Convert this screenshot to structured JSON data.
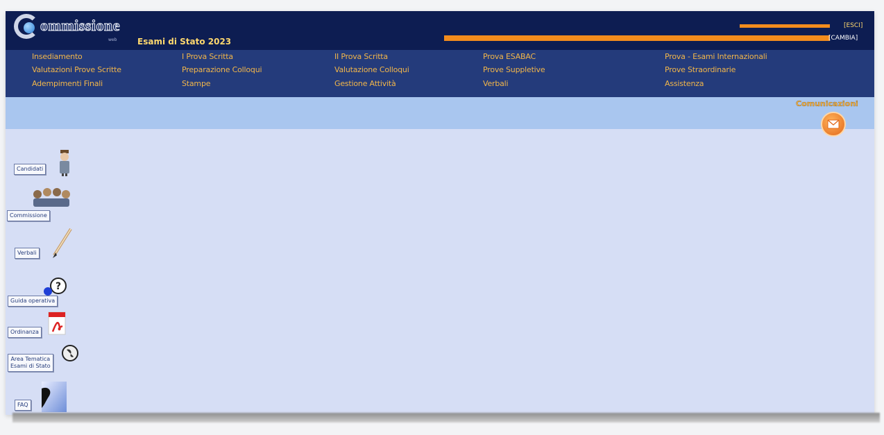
{
  "header": {
    "logo_text": "ommissione",
    "logo_sub": "web",
    "exam_title": "Esami di Stato 2023",
    "esci": "[ESCI]",
    "cambia": "[CAMBIA]"
  },
  "menu": {
    "col1": [
      "Insediamento",
      "Valutazioni Prove Scritte",
      "Adempimenti Finali"
    ],
    "col2": [
      "I Prova Scritta",
      "Preparazione Colloqui",
      "Stampe"
    ],
    "col3": [
      "II Prova Scritta",
      "Valutazione Colloqui",
      "Gestione Attività"
    ],
    "col4": [
      "Prova ESABAC",
      "Prove Suppletive",
      "Verbali"
    ],
    "col5": [
      "Prova - Esami Internazionali",
      "Prove Straordinarie",
      "Assistenza"
    ]
  },
  "comunicazioni": "Comunicazioni",
  "sidebar": [
    {
      "label": "Candidati",
      "icon": "candidate-icon"
    },
    {
      "label": "Commissione",
      "icon": "commission-icon"
    },
    {
      "label": "Verbali",
      "icon": "pen-icon"
    },
    {
      "label": "Guida operativa",
      "icon": "help-icon"
    },
    {
      "label": "Ordinanza",
      "icon": "pdf-icon"
    },
    {
      "label": "Area Tematica",
      "label2": "Esami di Stato",
      "icon": "globe-icon"
    },
    {
      "label": "FAQ",
      "icon": "faq-icon"
    }
  ],
  "colors": {
    "banner": "#0d1d52",
    "menu": "#243b7b",
    "menu_text": "#f2b64a",
    "band": "#a9c6ef",
    "content": "#d6def5",
    "accent": "#f28c1d"
  }
}
